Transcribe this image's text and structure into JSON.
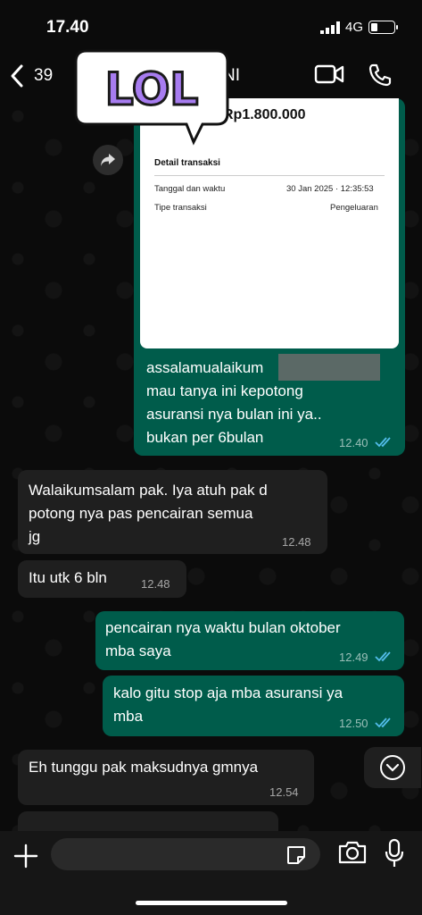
{
  "status": {
    "time": "17.40",
    "network": "4G"
  },
  "header": {
    "back_count": "39",
    "title_partial": "NI"
  },
  "sticker": {
    "text": "LOL"
  },
  "receipt": {
    "amount": "Rp1.800.000",
    "detail_title": "Detail transaksi",
    "rows": [
      {
        "label": "Tanggal dan waktu",
        "value": "30 Jan 2025 · 12:35:53"
      },
      {
        "label": "Tipe transaksi",
        "value": "Pengeluaran"
      }
    ]
  },
  "messages": [
    {
      "dir": "out",
      "lines": [
        "assalamualaikum",
        "mau tanya ini kepotong",
        "asuransi nya bulan ini ya..",
        "bukan per 6bulan"
      ],
      "time": "12.40"
    },
    {
      "dir": "in",
      "lines": [
        "Walaikumsalam pak. Iya atuh pak d",
        "potong nya pas pencairan semua",
        "jg"
      ],
      "time": "12.48"
    },
    {
      "dir": "in",
      "lines": [
        "Itu utk 6 bln"
      ],
      "time": "12.48"
    },
    {
      "dir": "out",
      "lines": [
        "pencairan nya waktu bulan oktober",
        "mba saya"
      ],
      "time": "12.49"
    },
    {
      "dir": "out",
      "lines": [
        "kalo gitu stop aja mba asuransi ya",
        "mba"
      ],
      "time": "12.50"
    },
    {
      "dir": "in",
      "lines": [
        "Eh tunggu pak maksudnya gmnya"
      ],
      "time": "12.54"
    }
  ],
  "input": {
    "value": ""
  },
  "colors": {
    "outgoing": "#005c4b",
    "incoming": "#1f1f1f",
    "read_ticks": "#53bdeb"
  }
}
